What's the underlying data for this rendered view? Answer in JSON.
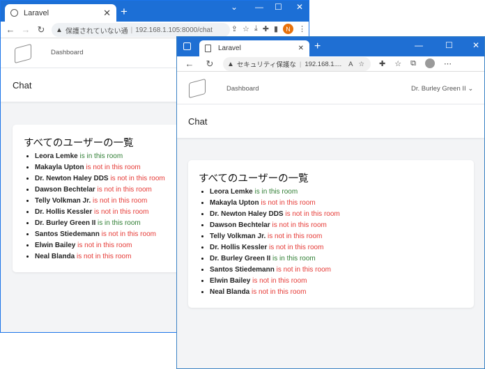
{
  "chrome": {
    "tab_title": "Laravel",
    "security_text": "保護されていない通",
    "url": "192.168.1.105:8000/chat",
    "profile_initial": "N"
  },
  "edge": {
    "tab_title": "Laravel",
    "security_text": "セキュリティ保護な",
    "url": "192.168.1....",
    "read_aloud_icon_text": "A"
  },
  "page": {
    "nav_dashboard": "Dashboard",
    "header_title": "Chat",
    "card_title": "すべてのユーザーの一覧",
    "status_in": "is in this room",
    "status_out": "is not in this room",
    "colors": {
      "in": "#2e7d32",
      "out": "#e53935"
    }
  },
  "win1_users": [
    {
      "name": "Leora Lemke",
      "status": "is in this room",
      "in_room": true
    },
    {
      "name": "Makayla Upton",
      "status": "is not in this room",
      "in_room": false
    },
    {
      "name": "Dr. Newton Haley DDS",
      "status": "is not in this room",
      "in_room": false
    },
    {
      "name": "Dawson Bechtelar",
      "status": "is not in this room",
      "in_room": false
    },
    {
      "name": "Telly Volkman Jr.",
      "status": "is not in this room",
      "in_room": false
    },
    {
      "name": "Dr. Hollis Kessler",
      "status": "is not in this room",
      "in_room": false
    },
    {
      "name": "Dr. Burley Green II",
      "status": "is in this room",
      "in_room": true
    },
    {
      "name": "Santos Stiedemann",
      "status": "is not in this room",
      "in_room": false
    },
    {
      "name": "Elwin Bailey",
      "status": "is not in this room",
      "in_room": false
    },
    {
      "name": "Neal Blanda",
      "status": "is not in this room",
      "in_room": false
    }
  ],
  "win2_user": {
    "name": "Dr. Burley Green II"
  },
  "win2_users": [
    {
      "name": "Leora Lemke",
      "status": "is in this room",
      "in_room": true
    },
    {
      "name": "Makayla Upton",
      "status": "is not in this room",
      "in_room": false
    },
    {
      "name": "Dr. Newton Haley DDS",
      "status": "is not in this room",
      "in_room": false
    },
    {
      "name": "Dawson Bechtelar",
      "status": "is not in this room",
      "in_room": false
    },
    {
      "name": "Telly Volkman Jr.",
      "status": "is not in this room",
      "in_room": false
    },
    {
      "name": "Dr. Hollis Kessler",
      "status": "is not in this room",
      "in_room": false
    },
    {
      "name": "Dr. Burley Green II",
      "status": "is in this room",
      "in_room": true
    },
    {
      "name": "Santos Stiedemann",
      "status": "is not in this room",
      "in_room": false
    },
    {
      "name": "Elwin Bailey",
      "status": "is not in this room",
      "in_room": false
    },
    {
      "name": "Neal Blanda",
      "status": "is not in this room",
      "in_room": false
    }
  ]
}
